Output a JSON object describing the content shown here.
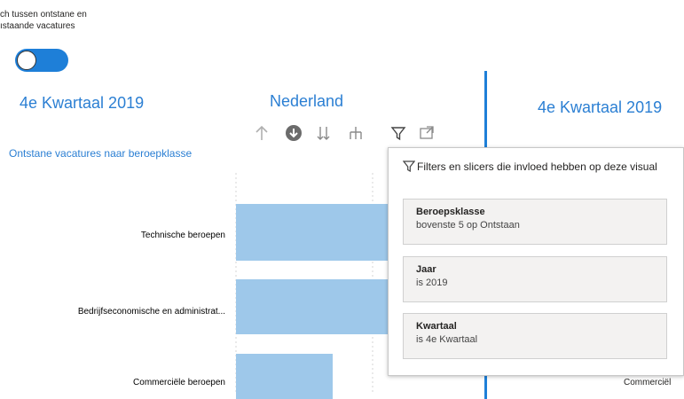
{
  "toggle": {
    "label": "ch tussen ontstane en\nıstaande vacatures",
    "state": "off"
  },
  "header": {
    "period_left": "4e Kwartaal  2019",
    "region": "Nederland",
    "period_right": "4e Kwartaal  2019"
  },
  "visual": {
    "title": "Ontstane vacatures naar beroepklasse",
    "toolbar_icons": [
      "arrow-up-icon",
      "drill-down-icon",
      "expand-all-icon",
      "hierarchy-icon",
      "filter-icon",
      "focus-mode-icon"
    ]
  },
  "chart_data": {
    "type": "bar",
    "orientation": "horizontal",
    "categories": [
      "Technische beroepen",
      "Bedrijfseconomische en administrat...",
      "Commerciële beroepen"
    ],
    "bar_color": "#9ec8ea"
  },
  "filter_popup": {
    "heading": "Filters en slicers die invloed hebben op deze visual",
    "cards": [
      {
        "title": "Beroepsklasse",
        "value": "bovenste 5 op Ontstaan"
      },
      {
        "title": "Jaar",
        "value": "is 2019"
      },
      {
        "title": "Kwartaal",
        "value": "is 4e Kwartaal"
      }
    ]
  },
  "right_visual": {
    "partial_label": "Commerciël"
  },
  "colors": {
    "accent": "#1e7fd8",
    "title_blue": "#2b7fd3"
  }
}
